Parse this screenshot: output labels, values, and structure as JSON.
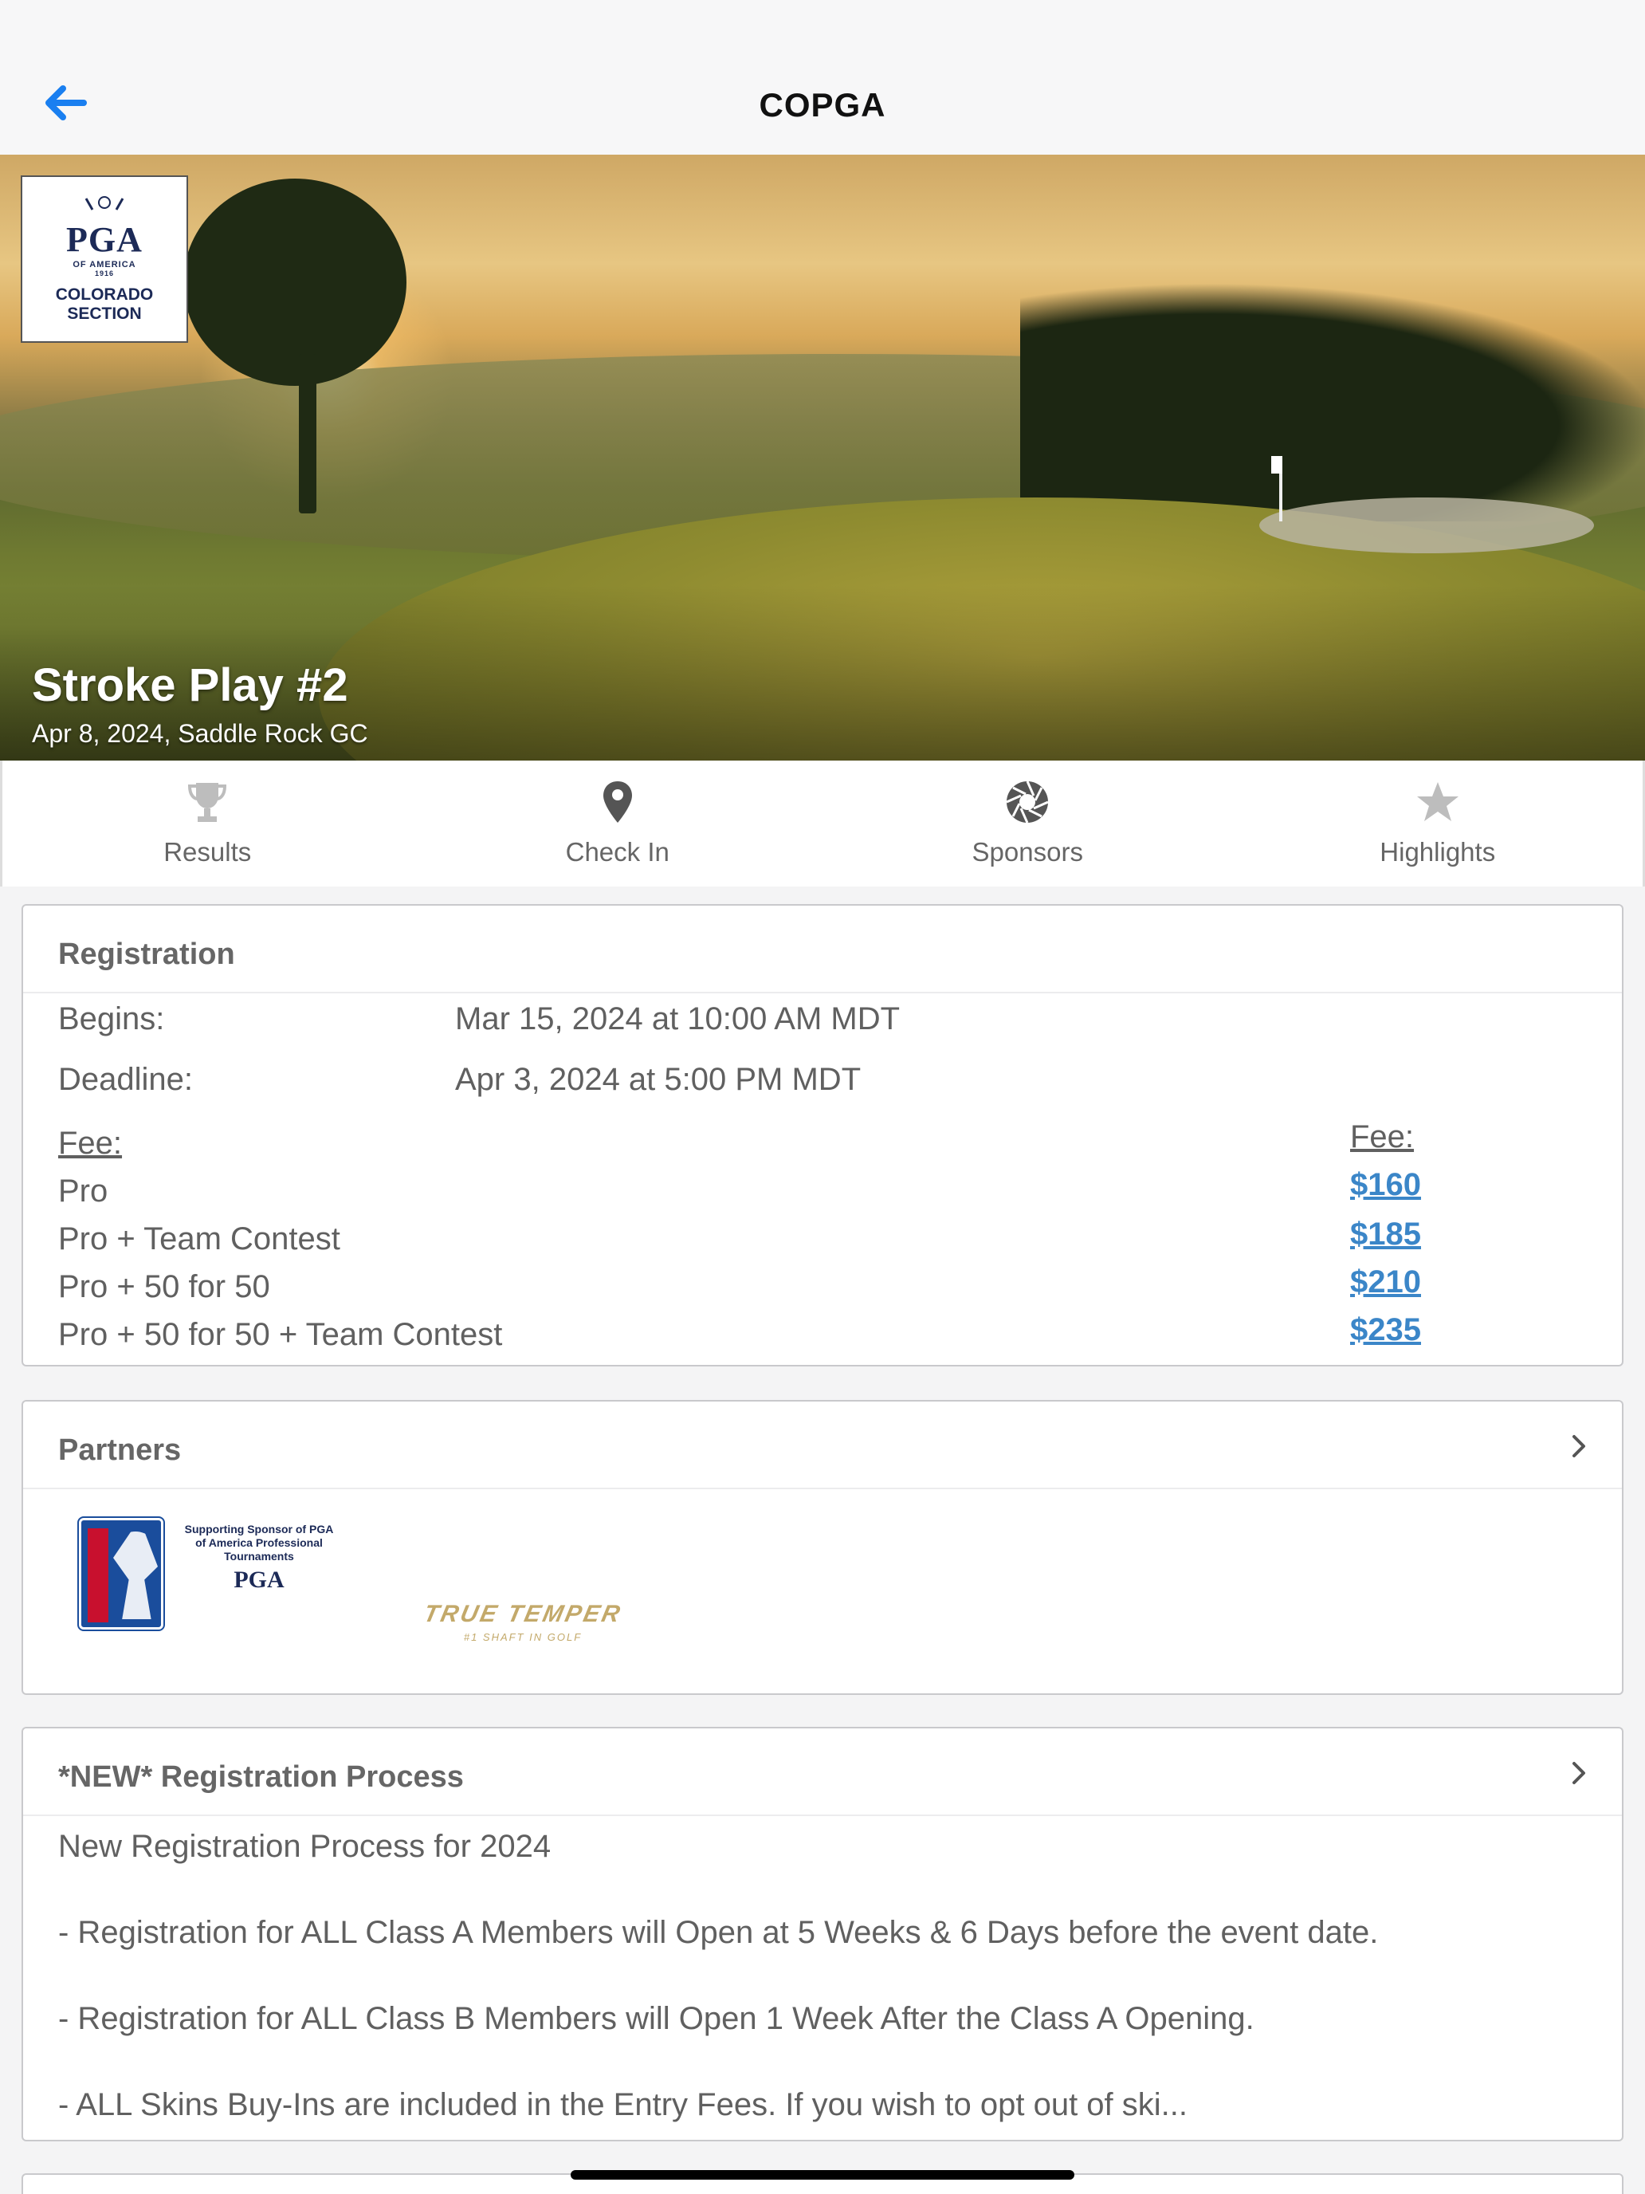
{
  "header": {
    "title": "COPGA"
  },
  "hero": {
    "logo": {
      "brand": "PGA",
      "sub1": "OF AMERICA",
      "sub2": "1916",
      "section_line1": "COLORADO",
      "section_line2": "SECTION"
    },
    "event_title": "Stroke Play #2",
    "event_subtitle": "Apr 8, 2024, Saddle Rock GC"
  },
  "actions": [
    {
      "label": "Results",
      "icon": "trophy-icon"
    },
    {
      "label": "Check In",
      "icon": "location-pin-icon"
    },
    {
      "label": "Sponsors",
      "icon": "aperture-icon"
    },
    {
      "label": "Highlights",
      "icon": "star-icon"
    }
  ],
  "registration": {
    "title": "Registration",
    "begins_label": "Begins:",
    "begins_value": "Mar 15, 2024 at 10:00 AM MDT",
    "deadline_label": "Deadline:",
    "deadline_value": "Apr 3, 2024 at 5:00 PM MDT",
    "fee_header_left": "Fee:",
    "fee_header_right": "Fee:",
    "fees": [
      {
        "name": "Pro",
        "price": "$160"
      },
      {
        "name": "Pro + Team Contest",
        "price": "$185"
      },
      {
        "name": "Pro + 50 for 50",
        "price": "$210"
      },
      {
        "name": "Pro + 50 for 50 + Team Contest",
        "price": "$235"
      }
    ]
  },
  "partners": {
    "title": "Partners",
    "tour_logo_text": "PGA TOUR",
    "supporting_text": "Supporting Sponsor of PGA of America Professional Tournaments",
    "supporting_brand": "PGA",
    "true_temper": "TRUE TEMPER",
    "true_temper_sub": "#1 SHAFT IN GOLF"
  },
  "process": {
    "title": "*NEW* Registration Process",
    "lines": [
      "New Registration Process for 2024",
      "- Registration for ALL Class A Members will Open at 5 Weeks & 6 Days before the event date.",
      "- Registration for ALL Class B Members will Open 1 Week After the Class A Opening.",
      "- ALL Skins Buy-Ins are included in the Entry Fees. If you wish to opt out of ski..."
    ]
  },
  "colors": {
    "accent": "#1a7ff0",
    "link": "#3b86c8",
    "brand_navy": "#1c2a57"
  }
}
